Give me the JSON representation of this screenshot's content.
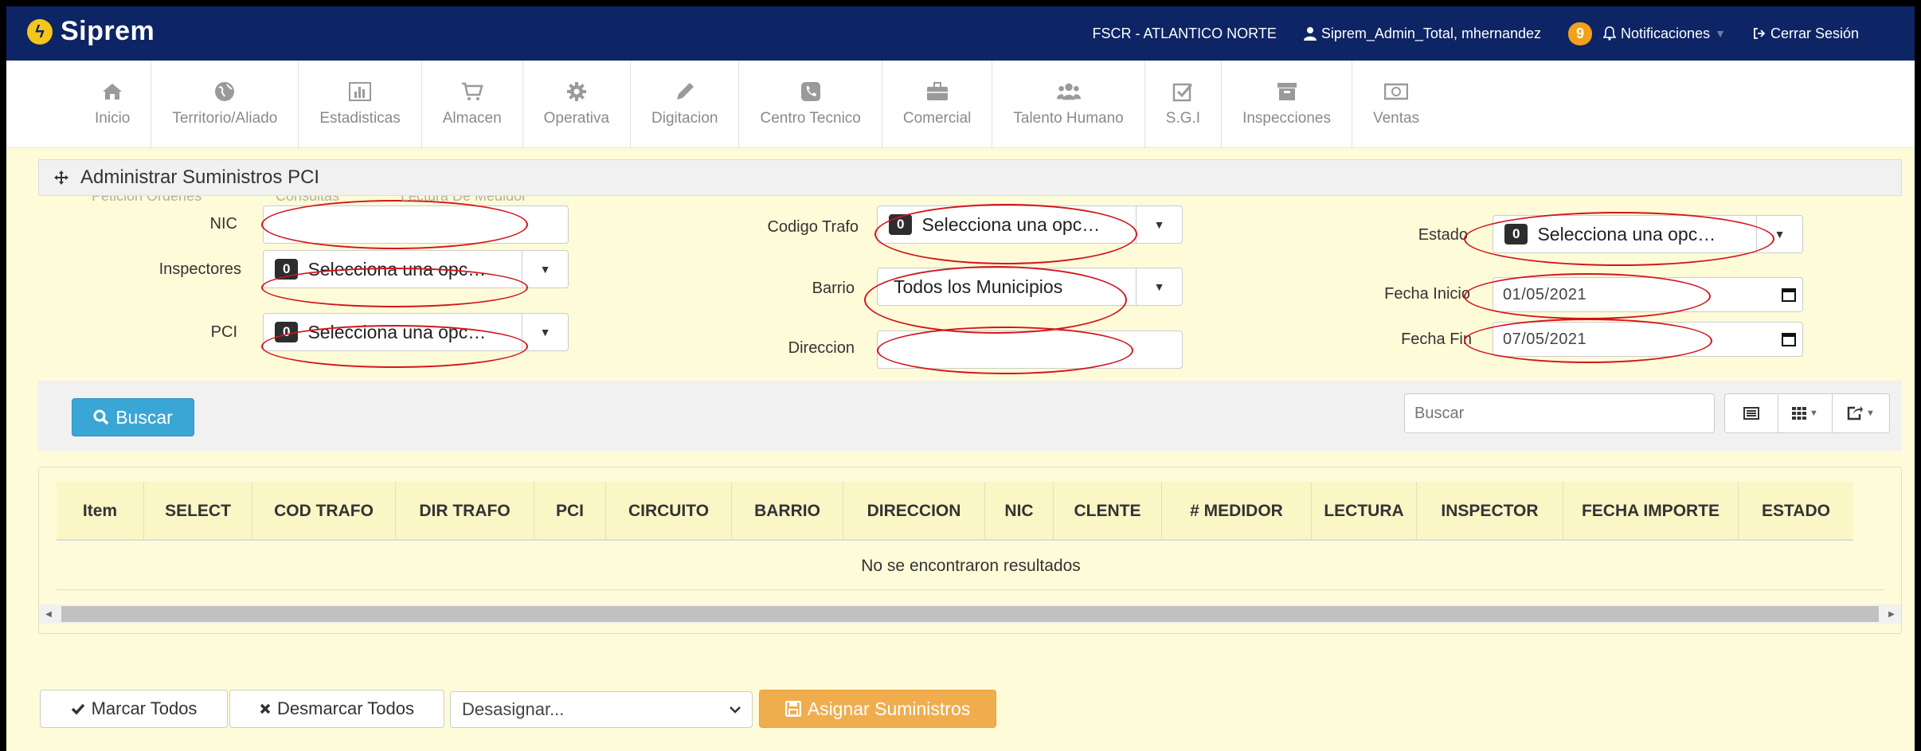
{
  "app": {
    "brand": "Siprem"
  },
  "topbar": {
    "location": "FSCR - ATLANTICO NORTE",
    "user": "Siprem_Admin_Total, mhernandez",
    "notif_count": "9",
    "notif_label": "Notificaciones",
    "logout": "Cerrar Sesión"
  },
  "menu": {
    "items": [
      {
        "label": "Inicio",
        "icon": "home-icon"
      },
      {
        "label": "Territorio/Aliado",
        "icon": "globe-icon"
      },
      {
        "label": "Estadisticas",
        "icon": "bar-chart-icon"
      },
      {
        "label": "Almacen",
        "icon": "cart-icon"
      },
      {
        "label": "Operativa",
        "icon": "gear-icon"
      },
      {
        "label": "Digitacion",
        "icon": "pencil-icon"
      },
      {
        "label": "Centro Tecnico",
        "icon": "phone-icon"
      },
      {
        "label": "Comercial",
        "icon": "briefcase-icon"
      },
      {
        "label": "Talento Humano",
        "icon": "users-icon"
      },
      {
        "label": "S.G.I",
        "icon": "check-square-icon"
      },
      {
        "label": "Inspecciones",
        "icon": "archive-icon"
      },
      {
        "label": "Ventas",
        "icon": "money-icon"
      }
    ]
  },
  "ghost_submenu": [
    "Peticion Ordenes",
    "Consultas",
    "Lectura De Medidor"
  ],
  "page": {
    "title": "Administrar Suministros PCI"
  },
  "form": {
    "nic_label": "NIC",
    "nic_value": "",
    "inspectores_label": "Inspectores",
    "inspectores_badge": "0",
    "inspectores_value": "Selecciona una opc…",
    "pci_label": "PCI",
    "pci_badge": "0",
    "pci_value": "Selecciona una opc…",
    "codigo_trafo_label": "Codigo Trafo",
    "codigo_trafo_badge": "0",
    "codigo_trafo_value": "Selecciona una opc…",
    "barrio_label": "Barrio",
    "barrio_value": "Todos los Municipios",
    "direccion_label": "Direccion",
    "direccion_value": "",
    "estado_label": "Estado",
    "estado_badge": "0",
    "estado_value": "Selecciona una opc…",
    "fecha_inicio_label": "Fecha Inicio",
    "fecha_inicio_value": "01/05/2021",
    "fecha_fin_label": "Fecha Fin",
    "fecha_fin_value": "07/05/2021"
  },
  "toolbar": {
    "buscar_label": "Buscar",
    "search_placeholder": "Buscar"
  },
  "table": {
    "columns": [
      "Item",
      "SELECT",
      "COD TRAFO",
      "DIR TRAFO",
      "PCI",
      "CIRCUITO",
      "BARRIO",
      "DIRECCION",
      "NIC",
      "CLENTE",
      "# MEDIDOR",
      "LECTURA",
      "INSPECTOR",
      "FECHA IMPORTE",
      "ESTADO"
    ],
    "empty_message": "No se encontraron resultados"
  },
  "bottom": {
    "marcar_todos": "Marcar Todos",
    "desmarcar_todos": "Desmarcar Todos",
    "desasignar": "Desasignar...",
    "asignar": "Asignar Suministros"
  },
  "colors": {
    "navbar": "#0d2465",
    "background": "#fefbd9",
    "primary_button": "#3aa6d6",
    "warning_button": "#f0ad4e",
    "annotation": "#d3151b"
  }
}
